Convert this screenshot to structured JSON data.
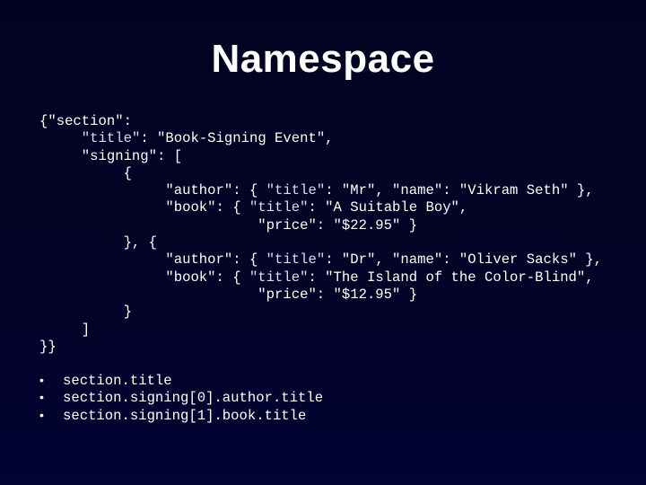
{
  "slide": {
    "title": "Namespace",
    "background_color": "#020220",
    "title_key_color": "#e6d6f8"
  },
  "code": {
    "lines": [
      [
        {
          "t": "{\"section\":"
        }
      ],
      [
        {
          "t": "     "
        },
        {
          "t": "\"title\"",
          "k": true
        },
        {
          "t": ": \"Book-Signing Event\","
        }
      ],
      [
        {
          "t": "     \"signing\": ["
        }
      ],
      [
        {
          "t": "          {"
        }
      ],
      [
        {
          "t": "               \"author\": { "
        },
        {
          "t": "\"title\"",
          "k": true
        },
        {
          "t": ": \"Mr\", \"name\": \"Vikram Seth\" },"
        }
      ],
      [
        {
          "t": "               \"book\": { "
        },
        {
          "t": "\"title\"",
          "k": true
        },
        {
          "t": ": \"A Suitable Boy\","
        }
      ],
      [
        {
          "t": "                          \"price\": \"$22.95\" }"
        }
      ],
      [
        {
          "t": "          }, {"
        }
      ],
      [
        {
          "t": "               \"author\": { "
        },
        {
          "t": "\"title\"",
          "k": true
        },
        {
          "t": ": \"Dr\", \"name\": \"Oliver Sacks\" },"
        }
      ],
      [
        {
          "t": "               \"book\": { "
        },
        {
          "t": "\"title\"",
          "k": true
        },
        {
          "t": ": \"The Island of the Color-Blind\","
        }
      ],
      [
        {
          "t": "                          \"price\": \"$12.95\" }"
        }
      ],
      [
        {
          "t": "          }"
        }
      ],
      [
        {
          "t": "     ]"
        }
      ],
      [
        {
          "t": "}}"
        }
      ]
    ]
  },
  "bullets": {
    "marker": "•",
    "items": [
      "section.title",
      "section.signing[0].author.title",
      "section.signing[1].book.title"
    ]
  }
}
